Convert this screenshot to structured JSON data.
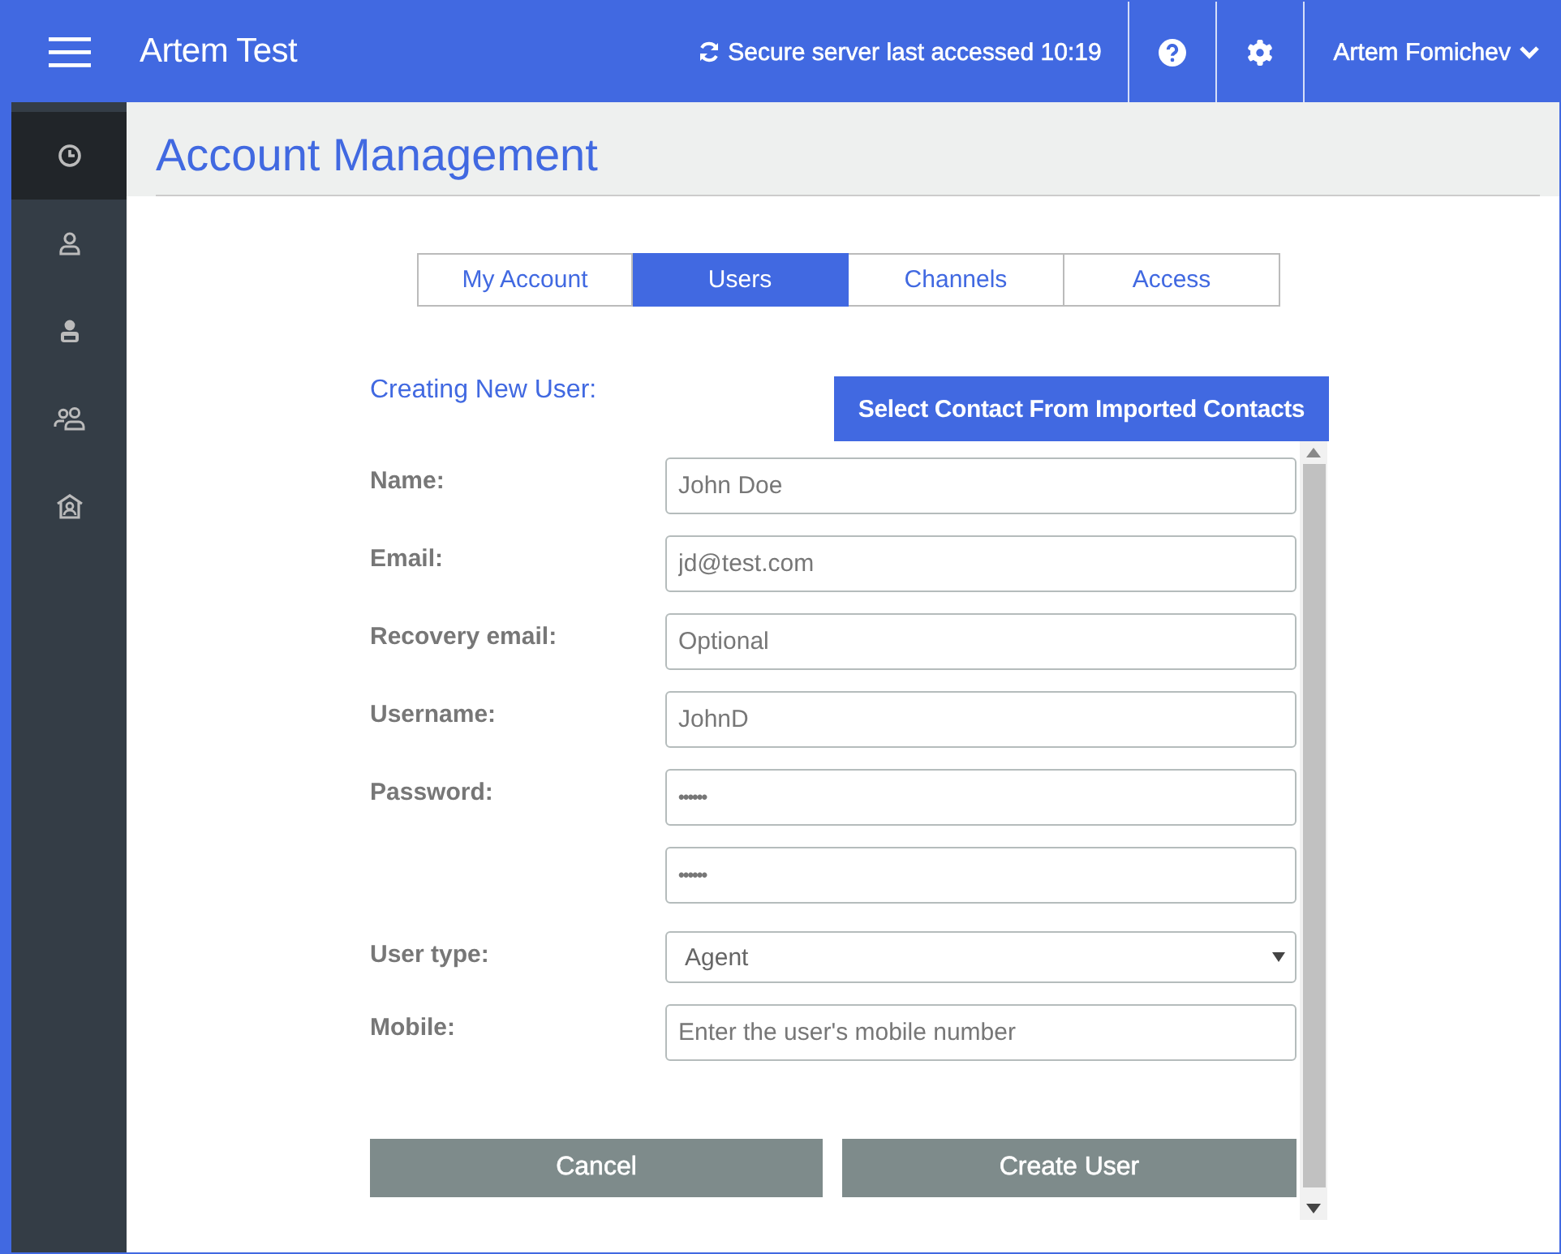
{
  "topbar": {
    "app_name": "Artem Test",
    "status": "Secure server last accessed 10:19",
    "user": "Artem Fomichev"
  },
  "sidebar": {
    "items": [
      {
        "kind": "clock",
        "selected": true
      },
      {
        "kind": "person",
        "selected": false
      },
      {
        "kind": "agent",
        "selected": false
      },
      {
        "kind": "people",
        "selected": false
      },
      {
        "kind": "home",
        "selected": false
      }
    ]
  },
  "page_title": "Account Management",
  "tabs": [
    {
      "label": "My Account",
      "selected": false
    },
    {
      "label": "Users",
      "selected": true
    },
    {
      "label": "Channels",
      "selected": false
    },
    {
      "label": "Access",
      "selected": false
    }
  ],
  "form": {
    "heading": "Creating New User:",
    "import_button": "Select Contact From Imported Contacts",
    "fields": [
      {
        "label": "Name:",
        "kind": "text",
        "value": "John Doe"
      },
      {
        "label": "Email:",
        "kind": "text",
        "value": "jd@test.com"
      },
      {
        "label": "Recovery email:",
        "kind": "text",
        "placeholder": "Optional"
      },
      {
        "label": "Username:",
        "kind": "text",
        "value": "JohnD"
      },
      {
        "label": "Password:",
        "kind": "password",
        "value": "••••••"
      },
      {
        "kind": "password",
        "value": "••••••"
      },
      {
        "label": "User type:",
        "kind": "select",
        "value": "Agent"
      },
      {
        "label": "Mobile:",
        "kind": "text",
        "placeholder": "Enter the user's mobile number"
      }
    ],
    "buttons": [
      "Cancel",
      "Create User"
    ]
  }
}
